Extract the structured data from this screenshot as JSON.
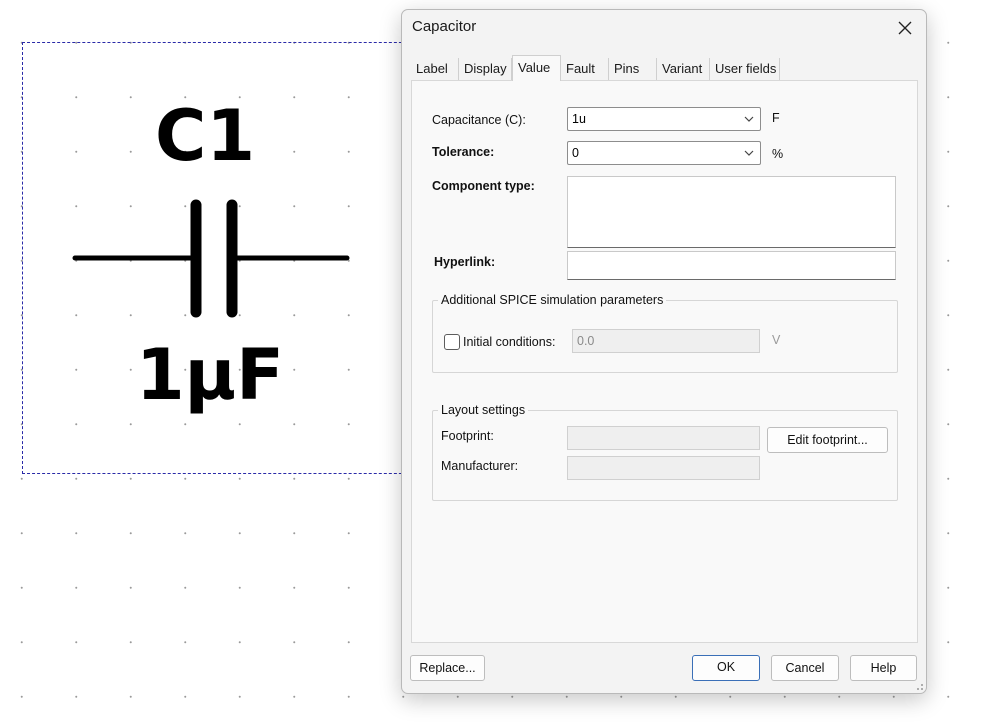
{
  "schematic": {
    "reference": "C1",
    "value": "1µF"
  },
  "dialog": {
    "title": "Capacitor",
    "tabs": [
      {
        "label": "Label"
      },
      {
        "label": "Display"
      },
      {
        "label": "Value",
        "active": true
      },
      {
        "label": "Fault"
      },
      {
        "label": "Pins"
      },
      {
        "label": "Variant"
      },
      {
        "label": "User fields"
      }
    ],
    "capacitance": {
      "label": "Capacitance (C):",
      "value": "1u",
      "unit": "F"
    },
    "tolerance": {
      "label": "Tolerance:",
      "value": "0",
      "unit": "%"
    },
    "component_type": {
      "label": "Component type:",
      "value": ""
    },
    "hyperlink": {
      "label": "Hyperlink:",
      "value": ""
    },
    "spice": {
      "title": "Additional SPICE simulation parameters",
      "initial_conditions": {
        "label": "Initial conditions:",
        "checked": false,
        "value": "0.0",
        "unit": "V"
      }
    },
    "layout": {
      "title": "Layout settings",
      "footprint_label": "Footprint:",
      "footprint_value": "",
      "edit_footprint_label": "Edit footprint...",
      "manufacturer_label": "Manufacturer:",
      "manufacturer_value": ""
    },
    "buttons": {
      "replace": "Replace...",
      "ok": "OK",
      "cancel": "Cancel",
      "help": "Help"
    }
  },
  "colors": {
    "selection_border": "#2a2aa8",
    "dialog_bg": "#f3f3f3",
    "primary_button_border": "#3a6fb7"
  }
}
